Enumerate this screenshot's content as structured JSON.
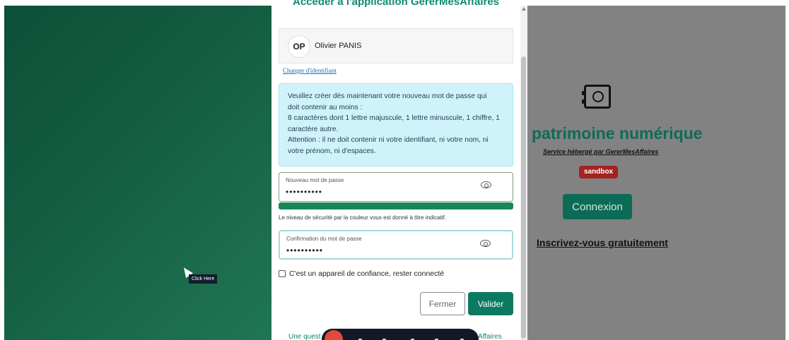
{
  "modal": {
    "title": "Accéder à l'application GererMesAffaires",
    "user": {
      "initials": "OP",
      "name": "Olivier PANIS"
    },
    "change_id_link": "Changer d'identifiant",
    "info_lines": [
      "Veuillez créer dès maintenant votre nouveau mot de passe qui",
      "doit contenir au moins :",
      "8 caractères dont 1 lettre majuscule, 1 lettre minuscule, 1 chiffre, 1",
      "caractère autre.",
      "Attention : il ne doit contenir ni votre identifiant, ni votre nom, ni",
      "votre prénom, ni d'espaces."
    ],
    "new_password": {
      "label": "Nouveau mot de passe",
      "value": "••••••••••"
    },
    "strength_note": "Le niveau de sécurité par la couleur vous est donné à titre indicatif.",
    "strength_color": "#198754",
    "confirm_password": {
      "label": "Confirmation du mot de passe",
      "value": "••••••••••"
    },
    "trust_device_label": "C'est un appareil de confiance, rester connecté",
    "close_button": "Fermer",
    "validate_button": "Valider",
    "footer_left": "Une quest",
    "footer_right": "Affaires"
  },
  "background": {
    "brand_title": "patrimoine numérique",
    "hosted_text": "Service hébergé par GererMesAffaires",
    "badge": "sandbox",
    "connect_button": "Connexion",
    "signup_link": "Inscrivez-vous gratuitement",
    "accent_color": "#0c6b56"
  },
  "cursor_tooltip": "Click Here"
}
